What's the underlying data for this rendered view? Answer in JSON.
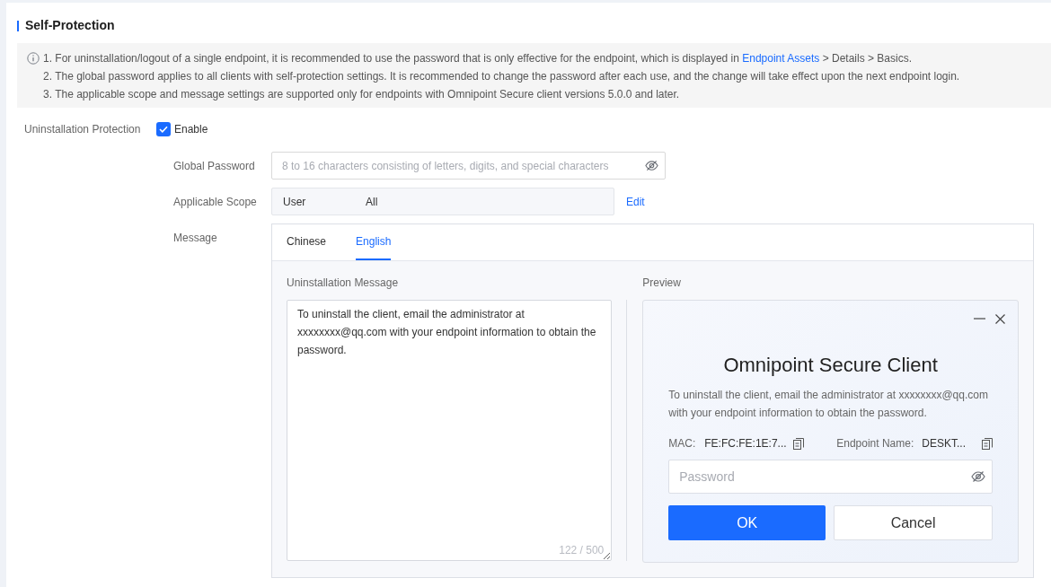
{
  "section": {
    "title": "Self-Protection"
  },
  "notice": {
    "items": [
      {
        "text": "1. For uninstallation/logout of a single endpoint, it is recommended to use the password that is only effective for the endpoint, which is displayed in ",
        "link": "Endpoint Assets",
        "text_after": " > Details > Basics."
      },
      {
        "text": "2. The global password applies to all clients with self-protection settings. It is recommended to change the password after each use, and the change will take effect upon the next endpoint login."
      },
      {
        "text": "3. The applicable scope and message settings are supported only for endpoints with Omnipoint Secure client versions 5.0.0 and later."
      }
    ]
  },
  "uninstallation_protection": {
    "label": "Uninstallation Protection",
    "checkbox_label": "Enable",
    "checked": true
  },
  "global_password": {
    "label": "Global Password",
    "placeholder": "8 to 16 characters consisting of letters, digits, and special characters"
  },
  "applicable_scope": {
    "label": "Applicable Scope",
    "type": "User",
    "value": "All",
    "edit_link": "Edit"
  },
  "message": {
    "label": "Message",
    "tabs": [
      {
        "label": "Chinese",
        "selected": false
      },
      {
        "label": "English",
        "selected": true
      }
    ],
    "editor": {
      "label": "Uninstallation Message",
      "value": "To uninstall the client, email the administrator at xxxxxxxx@qq.com with your endpoint information to obtain the password.",
      "counter": "122 / 500"
    },
    "preview": {
      "label": "Preview",
      "title": "Omnipoint Secure Client",
      "message": "To uninstall the client, email the administrator at xxxxxxxx@qq.com with your endpoint information to obtain the password.",
      "mac_label": "MAC:",
      "mac_value": "FE:FC:FE:1E:7...",
      "endpoint_label": "Endpoint Name:",
      "endpoint_value": "DESKT...",
      "password_placeholder": "Password",
      "buttons": [
        {
          "label": "OK",
          "kind": "primary"
        },
        {
          "label": "Cancel",
          "kind": "secondary"
        }
      ]
    }
  }
}
